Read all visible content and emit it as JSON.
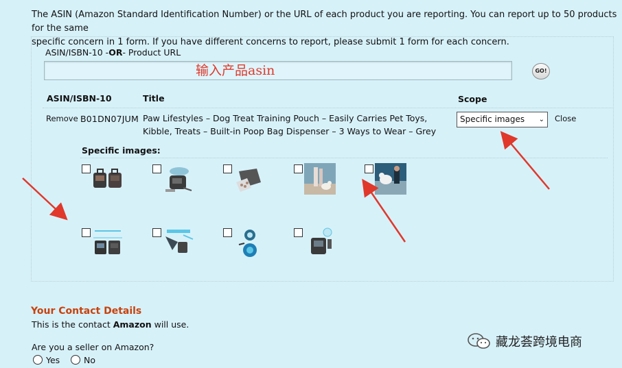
{
  "intro": {
    "line1": "The ASIN (Amazon Standard Identification Number) or the URL of each product you are reporting. You can report up to 50 products for the same",
    "line2": "specific concern in 1 form. If you have different concerns to report, please submit 1 form for each concern."
  },
  "asin_field": {
    "label_pre": "ASIN/ISBN-10 -",
    "label_or": "OR",
    "label_post": "- Product URL",
    "value": "输入产品asin",
    "go_label": "GO!"
  },
  "table": {
    "headers": [
      "ASIN/ISBN-10",
      "Title",
      "Scope"
    ],
    "row": {
      "remove_label": "Remove",
      "asin": "B01DN07JUM",
      "title": "Paw Lifestyles – Dog Treat Training Pouch – Easily Carries Pet Toys, Kibble, Treats – Built-in Poop Bag Dispenser – 3 Ways to Wear – Grey",
      "scope": "Specific images",
      "close_label": "Close"
    },
    "specific_images_label": "Specific images:"
  },
  "images": [
    {
      "name": "pouch-front-back",
      "checked": false
    },
    {
      "name": "pouch-on-hip",
      "checked": false
    },
    {
      "name": "pouch-open-kibble",
      "checked": false
    },
    {
      "name": "dog-walk-photo",
      "checked": false
    },
    {
      "name": "dog-play-photo",
      "checked": false
    },
    {
      "name": "pouch-dimensions",
      "checked": false
    },
    {
      "name": "pouch-features",
      "checked": false
    },
    {
      "name": "pouch-detail-circles",
      "checked": false
    },
    {
      "name": "pouch-belt-clip",
      "checked": false
    }
  ],
  "contact": {
    "heading": "Your Contact Details",
    "sub_pre": "This is the contact ",
    "sub_bold": "Amazon",
    "sub_post": " will use.",
    "seller_question": "Are you a seller on Amazon?",
    "options": [
      "Yes",
      "No"
    ]
  },
  "watermark": "藏龙荟跨境电商",
  "colors": {
    "accent": "#c8420c",
    "annotation": "#e0382b",
    "background": "#d7f1f9"
  }
}
